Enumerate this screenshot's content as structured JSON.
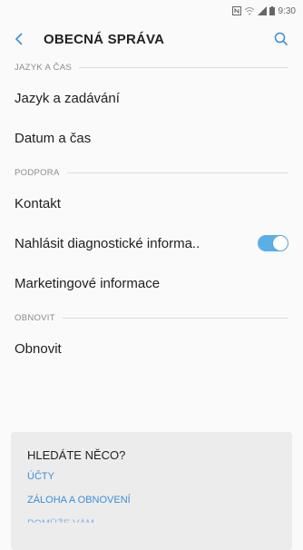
{
  "status_bar": {
    "time": "9:30"
  },
  "header": {
    "title": "OBECNÁ SPRÁVA"
  },
  "sections": [
    {
      "header": "JAZYK A ČAS",
      "items": [
        "Jazyk a zadávání",
        "Datum a čas"
      ]
    },
    {
      "header": "PODPORA",
      "items": [
        "Kontakt",
        "Nahlásit diagnostické informa..",
        "Marketingové informace"
      ]
    },
    {
      "header": "OBNOVIT",
      "items": [
        "Obnovit"
      ]
    }
  ],
  "diagnostics_toggle": {
    "on": true
  },
  "card": {
    "title": "HLEDÁTE NĚCO?",
    "links": [
      "ÚČTY",
      "ZÁLOHA A OBNOVENÍ",
      "POMŮŽE VÁM"
    ]
  },
  "colors": {
    "accent": "#3a8fd6",
    "toggle_on": "#5ab0e6"
  }
}
